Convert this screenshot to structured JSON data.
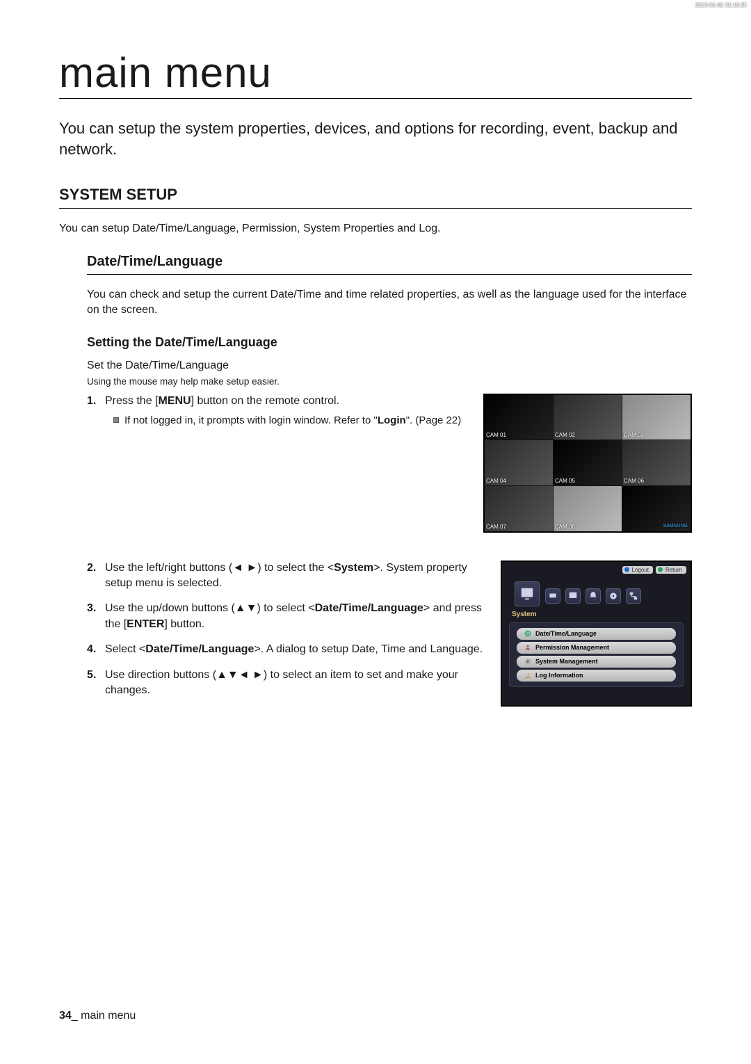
{
  "page": {
    "title": "main menu",
    "intro": "You can setup the system properties, devices, and options for recording, event, backup and network.",
    "h2": "SYSTEM SETUP",
    "h2_desc": "You can setup Date/Time/Language, Permission, System Properties and Log.",
    "h3": "Date/Time/Language",
    "h3_desc": "You can check and setup the current Date/Time and time related properties, as well as the language used for the interface on the screen.",
    "h4": "Setting the Date/Time/Language",
    "h4_sub1": "Set the Date/Time/Language",
    "h4_sub2": "Using the mouse may help make setup easier.",
    "step1a": "Press the [",
    "step1b": "MENU",
    "step1c": "] button on the remote control.",
    "step1_bullet_a": "If not logged in, it prompts with login window. Refer to \"",
    "step1_bullet_b": "Login",
    "step1_bullet_c": "\". (Page 22)",
    "step2a": "Use the left/right buttons (◄ ►) to select the <",
    "step2b": "System",
    "step2c": ">. System property setup menu is selected.",
    "step3a": "Use the up/down buttons (▲▼) to select <",
    "step3b": "Date/Time/Language",
    "step3c": "> and press the [",
    "step3d": "ENTER",
    "step3e": "] button.",
    "step4a": "Select <",
    "step4b": "Date/Time/Language",
    "step4c": ">. A dialog to setup Date, Time and Language.",
    "step5": "Use direction buttons (▲▼◄ ►) to select an item to set and make your changes."
  },
  "screenshot1": {
    "timestamp": "2013-01-01 01:10:25",
    "cams": [
      "CAM 01",
      "CAM 02",
      "CAM 03",
      "CAM 04",
      "CAM 05",
      "CAM 06",
      "CAM 07",
      "CAM 08",
      ""
    ],
    "brand": "SAMSUNG"
  },
  "screenshot2": {
    "logout": "Logout",
    "return": "Return",
    "section_title": "System",
    "items": [
      "Date/Time/Language",
      "Permission Management",
      "System Management",
      "Log Information"
    ]
  },
  "footer": {
    "pagenum": "34",
    "sep": "_ ",
    "label": "main menu"
  }
}
